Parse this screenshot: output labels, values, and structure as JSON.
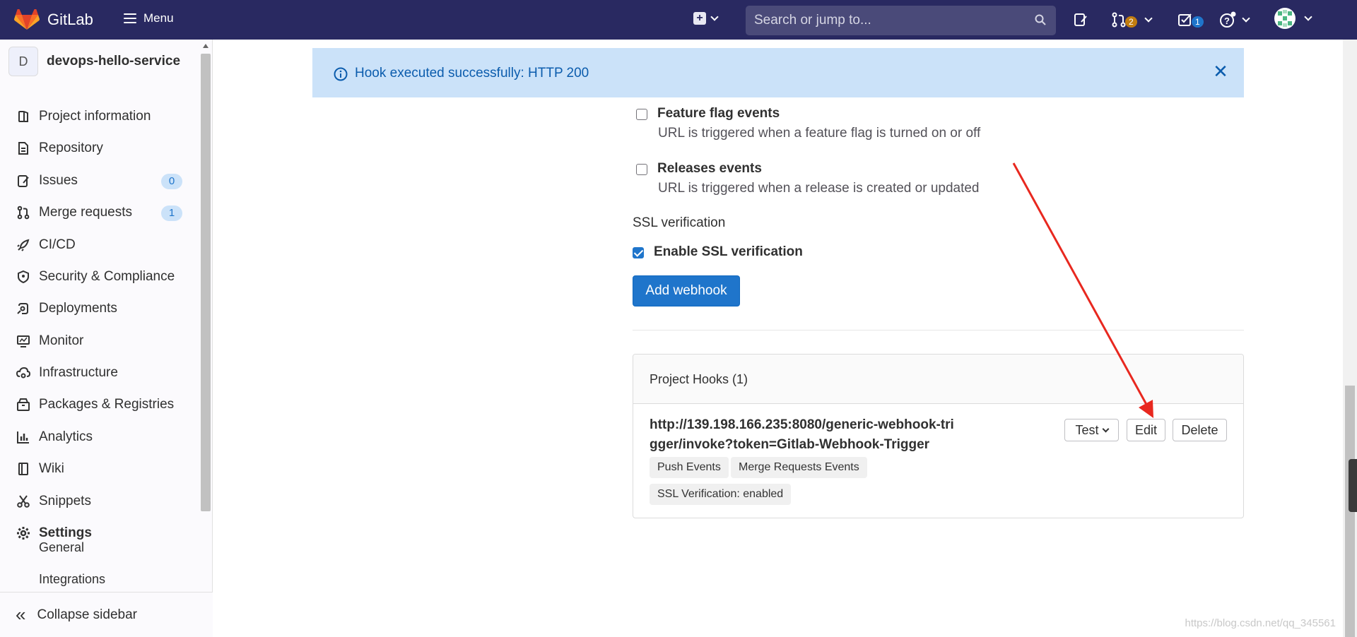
{
  "navbar": {
    "brand": "GitLab",
    "menu_label": "Menu",
    "search_placeholder": "Search or jump to...",
    "merge_requests_count": "2",
    "todos_count": "1",
    "icons": [
      "gitlab-logo-icon",
      "menu-icon",
      "plus-square-icon",
      "search-icon",
      "issues-icon",
      "merge-request-icon",
      "todo-icon",
      "help-icon",
      "avatar"
    ]
  },
  "sidebar": {
    "project_initial": "D",
    "project_name": "devops-hello-service",
    "items": [
      {
        "label": "Project information",
        "icon": "project-icon"
      },
      {
        "label": "Repository",
        "icon": "doc-text-icon"
      },
      {
        "label": "Issues",
        "icon": "issues-icon",
        "count": "0"
      },
      {
        "label": "Merge requests",
        "icon": "git-merge-icon",
        "count": "1"
      },
      {
        "label": "CI/CD",
        "icon": "rocket-icon"
      },
      {
        "label": "Security & Compliance",
        "icon": "shield-icon"
      },
      {
        "label": "Deployments",
        "icon": "deployments-icon"
      },
      {
        "label": "Monitor",
        "icon": "monitor-icon"
      },
      {
        "label": "Infrastructure",
        "icon": "cloud-gear-icon"
      },
      {
        "label": "Packages & Registries",
        "icon": "package-icon"
      },
      {
        "label": "Analytics",
        "icon": "chart-icon"
      },
      {
        "label": "Wiki",
        "icon": "book-icon"
      },
      {
        "label": "Snippets",
        "icon": "scissors-icon"
      },
      {
        "label": "Settings",
        "icon": "settings-icon"
      }
    ],
    "sub_items": [
      "General",
      "Integrations"
    ],
    "collapse_label": "Collapse sidebar"
  },
  "alert": {
    "message": "Hook executed successfully: HTTP 200"
  },
  "triggers": [
    {
      "title": "Feature flag events",
      "description": "URL is triggered when a feature flag is turned on or off",
      "checked": false
    },
    {
      "title": "Releases events",
      "description": "URL is triggered when a release is created or updated",
      "checked": false
    }
  ],
  "ssl": {
    "section_label": "SSL verification",
    "checkbox_label": "Enable SSL verification",
    "checked": true
  },
  "add_button": "Add webhook",
  "project_hooks": {
    "header": "Project Hooks (1)",
    "hooks": [
      {
        "url": "http://139.198.166.235:8080/generic-webhook-trigger/invoke?token=Gitlab-Webhook-Trigger",
        "tags": [
          "Push Events",
          "Merge Requests Events",
          "SSL Verification: enabled"
        ],
        "test_label": "Test",
        "edit_label": "Edit",
        "delete_label": "Delete"
      }
    ]
  },
  "watermark": "https://blog.csdn.net/qq_345561",
  "colors": {
    "navbar": "#292961",
    "primary": "#1f75cb",
    "alert_bg": "#cbe2f9",
    "annotation_arrow": "#e8281f"
  }
}
